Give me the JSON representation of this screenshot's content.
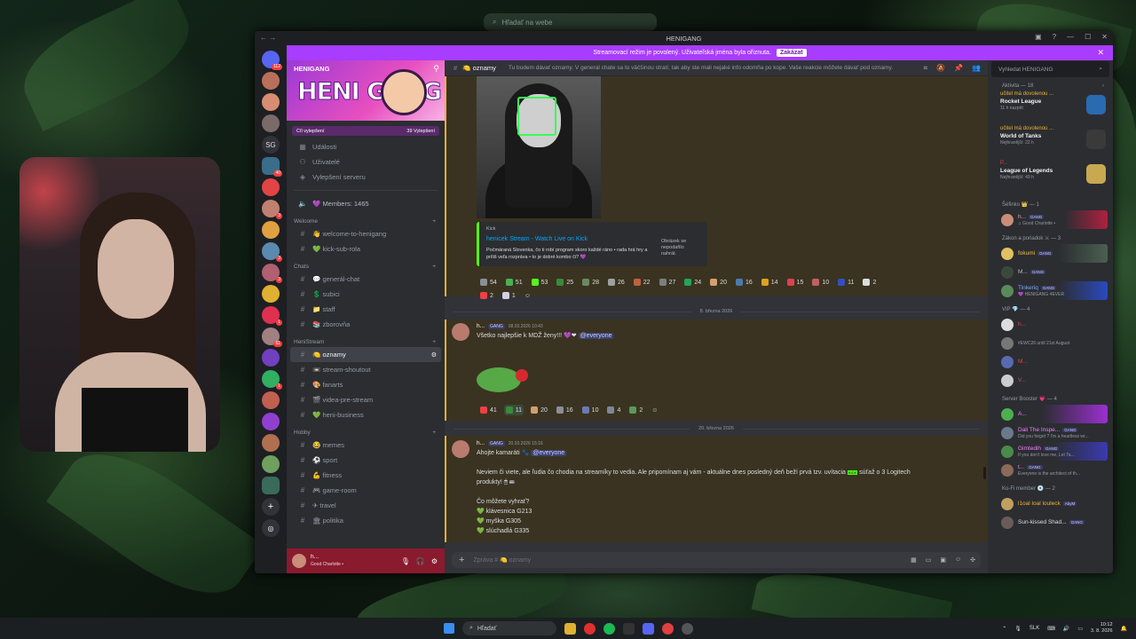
{
  "browser_search_placeholder": "Hľadať na webe",
  "window": {
    "title": "HENIGANG"
  },
  "banner": {
    "text": "Streamovací režim je povolený. Uživateľská jména byla ořiznuta.",
    "button": "Zakázat"
  },
  "server": {
    "name": "HENIGANG",
    "logo_text": "HENI GANG",
    "boost_left": "Cíl vylepšení",
    "boost_right": "39 Vylepšení",
    "top_items": [
      "Události",
      "Uživatelé",
      "Vylepšení serveru"
    ],
    "members_channel": "Members: 1465",
    "categories": [
      {
        "name": "Welcome",
        "channels": [
          "welcome-to-henigang",
          "kick-sub-rola"
        ]
      },
      {
        "name": "Chats",
        "channels": [
          "generál-chat",
          "subici",
          "staff",
          "zborovňa"
        ]
      },
      {
        "name": "HeniStream",
        "channels": [
          "oznamy",
          "stream-shoutout",
          "fanarts",
          "videa-pre-stream",
          "heni-business"
        ]
      },
      {
        "name": "Hobby",
        "channels": [
          "memes",
          "sport",
          "fitness",
          "game-room",
          "travel",
          "politika"
        ]
      }
    ],
    "active_channel": "oznamy"
  },
  "user_panel": {
    "name": "h...",
    "status": "Good Charlotte •"
  },
  "chat": {
    "channel": "oznamy",
    "topic": "Tu budem dávať oznamy. V general chate sa to väčšinou stratí, tak aby ste mali nejaké info odomňa po kope. Vaše reakcie môžete dávať pod oznamy.",
    "embed": {
      "source": "Kick",
      "title": "henicek Stream - Watch Live on Kick",
      "description": "Počmáraná Slovenka, čo ti robí program skoro každé ráno • rada hrá hry a príliš veľa rozpráva • to je dobré kombo či? 💜",
      "side_note": "Obrázek se nepodařilo nahrát."
    },
    "reactions_1": [
      "54",
      "51",
      "53",
      "25",
      "28",
      "26",
      "22",
      "27",
      "24",
      "20",
      "16",
      "14",
      "15",
      "10",
      "11",
      "2"
    ],
    "reactions_1b": [
      "2",
      "1"
    ],
    "divider_1": "8. března 2026",
    "msg_1": {
      "author": "h...",
      "tag": "GANG",
      "time": "08.03.2026 10:43",
      "text": "Všetko najlepšie k MDŽ ženy!!!",
      "mention": "@everyone"
    },
    "reactions_2": [
      "41",
      "11",
      "20",
      "16",
      "10",
      "4",
      "2"
    ],
    "divider_2": "20. března 2026",
    "msg_2": {
      "author": "h...",
      "tag": "GANG",
      "time": "20.03.2026 15:16",
      "line1": "Ahojte kamaráti",
      "mention": "@everyone",
      "line2": "Neviem či viete, ale ľudia čo chodia na streamíky to vedia. Ale pripomínam aj vám - aktuálne dnes posledný deň beží prvá tzv. uvítacia",
      "line2b": "súťaž o 3 Logitech",
      "line3": "produkty!",
      "q": "Čo môžete vyhrať?",
      "items": [
        "klávesnica G213",
        "myška G305",
        "slúchadlá G335"
      ]
    },
    "composer_placeholder": "Zpráva # 🍋 oznamy"
  },
  "members": {
    "search_placeholder": "Vyhledat HENIGANG",
    "activity_header": "Aktivita — 18",
    "activities": [
      {
        "user": "učitel má dovolenou ...",
        "game": "Rocket League",
        "time": "11 h nazpět"
      },
      {
        "user": "učitel má dovolenou ...",
        "game": "World of Tanks",
        "time": "Nejhranější: 22 h"
      },
      {
        "user": "P...",
        "game": "League of Legends",
        "time": "Nejhranější: 49 h"
      }
    ],
    "groups": [
      {
        "name": "Šéfinko 👑 — 1",
        "rows": [
          {
            "n": "h...",
            "s": "♫ Good Charlotte •",
            "tag": "GANG",
            "c": "#e8a0b0"
          }
        ]
      },
      {
        "name": "Zákon a poriadok ⚔ — 3",
        "rows": [
          {
            "n": "fokumi",
            "s": "",
            "tag": "GANG",
            "c": "#f0c040"
          },
          {
            "n": "M...",
            "s": "",
            "tag": "GANG",
            "c": "#bbbbbb"
          },
          {
            "n": "Tinkeriq",
            "s": "💜 HENIGANG 4EVER",
            "tag": "GANG",
            "c": "#7aa8ff"
          }
        ]
      },
      {
        "name": "VIP 💎 — 4",
        "rows": [
          {
            "n": "h...",
            "s": "",
            "tag": "",
            "c": "#f23f43"
          },
          {
            "n": "",
            "s": "#EWC26 until 21st August",
            "tag": "",
            "c": "#cccccc"
          },
          {
            "n": "M...",
            "s": "",
            "tag": "",
            "c": "#f23f43"
          },
          {
            "n": "V...",
            "s": "",
            "tag": "",
            "c": "#bb5566"
          }
        ]
      },
      {
        "name": "Server Booster 💗 — 4",
        "rows": [
          {
            "n": "A...",
            "s": "",
            "tag": "",
            "c": "#f47fff"
          },
          {
            "n": "Dali The Inspe...",
            "s": "Did you forget ? I'm a heartless wr...",
            "tag": "GANG",
            "c": "#f47fff"
          },
          {
            "n": "Gimtedih",
            "s": "If you don't love me, Let Ta...",
            "tag": "GANG",
            "c": "#f47fff"
          },
          {
            "n": "t...",
            "s": "Everyone is the architect of th...",
            "tag": "GANG",
            "c": "#f47fff"
          }
        ]
      },
      {
        "name": "Ko-Fi member 💿 — 2",
        "rows": [
          {
            "n": "l1oal loal louleck",
            "s": "",
            "tag": "AbyM",
            "c": "#f0b232"
          },
          {
            "n": "Sun-kissed Shad...",
            "s": "",
            "tag": "GANG",
            "c": "#dbdee1"
          }
        ]
      }
    ]
  },
  "taskbar": {
    "search": "Hľadať",
    "lang": "SLK",
    "time": "10:12",
    "date": "3. 8. 2026"
  }
}
